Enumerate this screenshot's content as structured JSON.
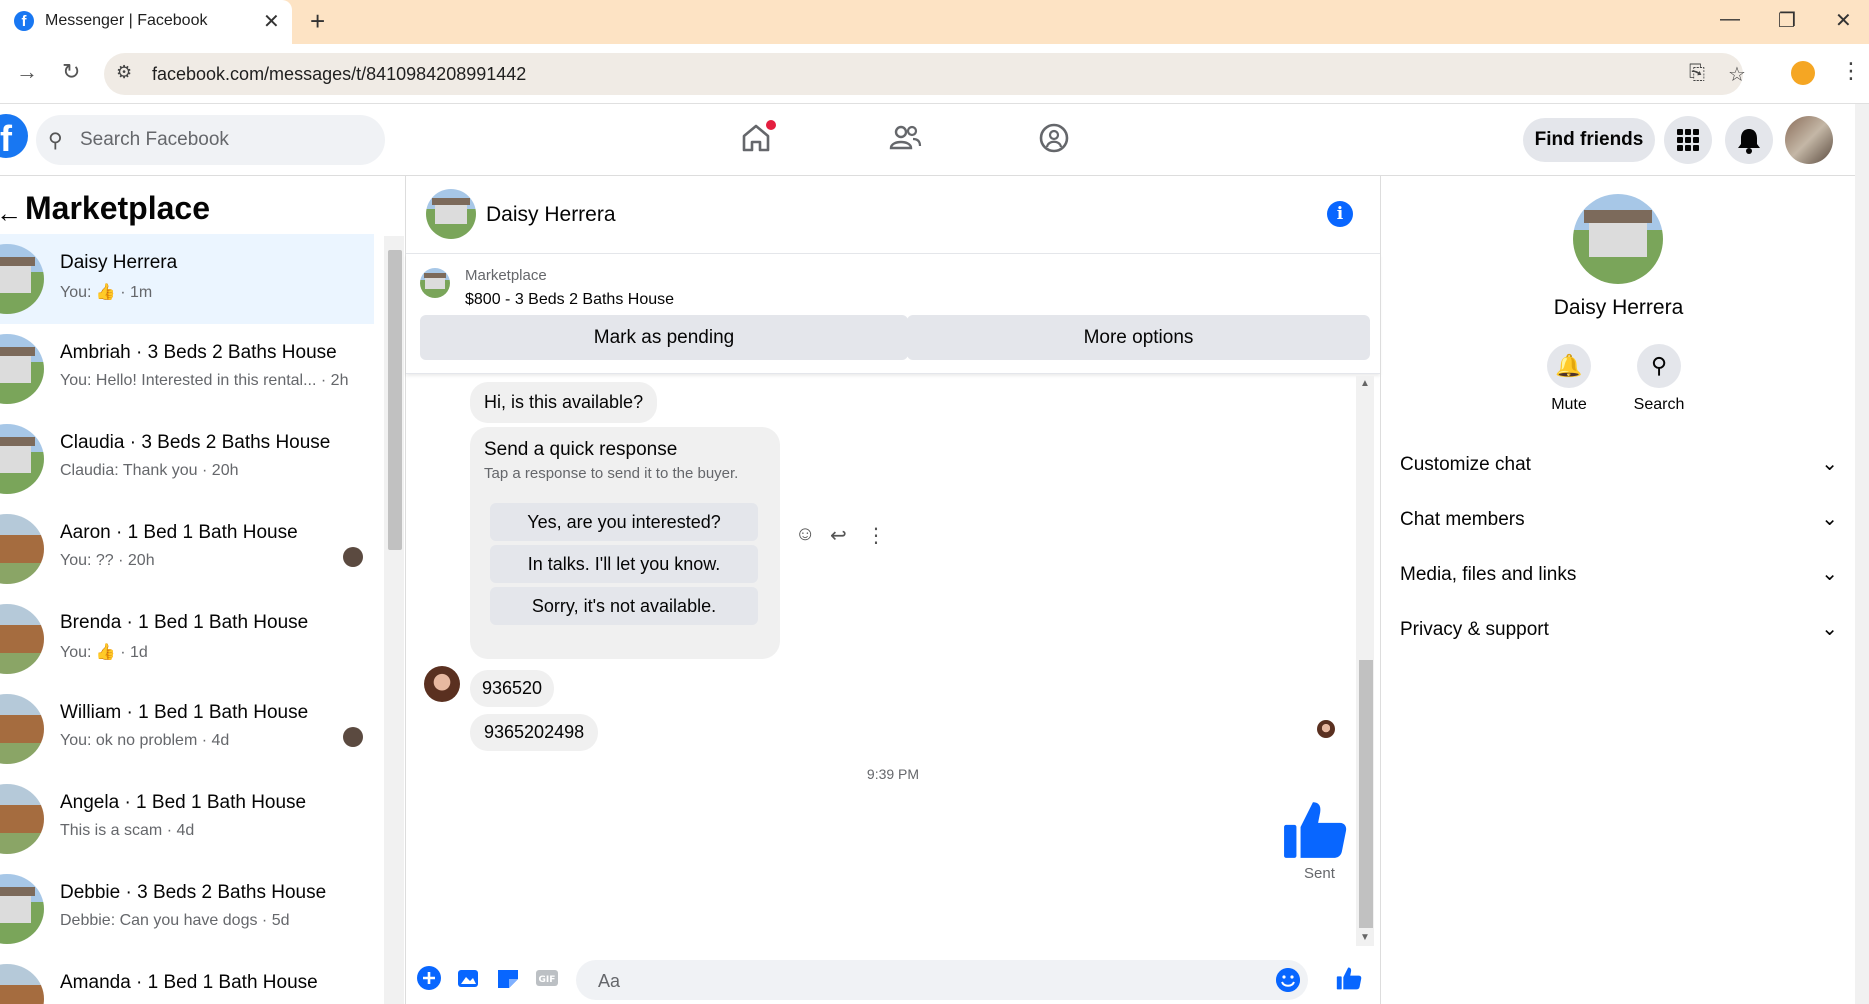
{
  "browser": {
    "tab_title": "Messenger | Facebook",
    "url": "facebook.com/messages/t/8410984208991442"
  },
  "header": {
    "search_placeholder": "Search Facebook",
    "find_friends": "Find friends"
  },
  "sidebar": {
    "title": "Marketplace",
    "conversations": [
      {
        "name": "Daisy Herrera",
        "preview": "You: 👍 · 1m",
        "thumb": "house",
        "active": true
      },
      {
        "name": "Ambriah · 3 Beds 2 Baths House",
        "preview": "You: Hello! Interested in this rental... · 2h",
        "thumb": "house"
      },
      {
        "name": "Claudia · 3 Beds 2 Baths House",
        "preview": "Claudia: Thank you · 20h",
        "thumb": "house"
      },
      {
        "name": "Aaron · 1 Bed 1 Bath House",
        "preview": "You: ?? · 20h",
        "thumb": "cabin",
        "seen": true
      },
      {
        "name": "Brenda · 1 Bed 1 Bath House",
        "preview": "You: 👍 · 1d",
        "thumb": "cabin"
      },
      {
        "name": "William · 1 Bed 1 Bath House",
        "preview": "You: ok no problem · 4d",
        "thumb": "cabin",
        "seen": true
      },
      {
        "name": "Angela · 1 Bed 1 Bath House",
        "preview": "This is a scam · 4d",
        "thumb": "cabin"
      },
      {
        "name": "Debbie · 3 Beds 2 Baths House",
        "preview": "Debbie: Can you have dogs · 5d",
        "thumb": "house"
      },
      {
        "name": "Amanda · 1 Bed 1 Bath House",
        "preview": "",
        "thumb": "cabin"
      }
    ]
  },
  "chat": {
    "contact_name": "Daisy Herrera",
    "marketplace_label": "Marketplace",
    "listing_title": "$800 - 3 Beds 2 Baths House",
    "mark_pending": "Mark as pending",
    "more_options": "More options",
    "msg1": "Hi, is this available?",
    "quick_title": "Send a quick response",
    "quick_sub": "Tap a response to send it to the buyer.",
    "quick_opts": [
      "Yes, are you interested?",
      "In talks. I'll let you know.",
      "Sorry, it's not available."
    ],
    "msg2": "936520",
    "msg3": "9365202498",
    "timestamp": "9:39 PM",
    "sent": "Sent",
    "composer_placeholder": "Aa"
  },
  "info": {
    "name": "Daisy Herrera",
    "mute": "Mute",
    "search": "Search",
    "sections": [
      "Customize chat",
      "Chat members",
      "Media, files and links",
      "Privacy & support"
    ]
  },
  "colors": {
    "brand": "#1877f2",
    "messenger_blue": "#0866ff",
    "active_row": "#ebf5ff"
  }
}
